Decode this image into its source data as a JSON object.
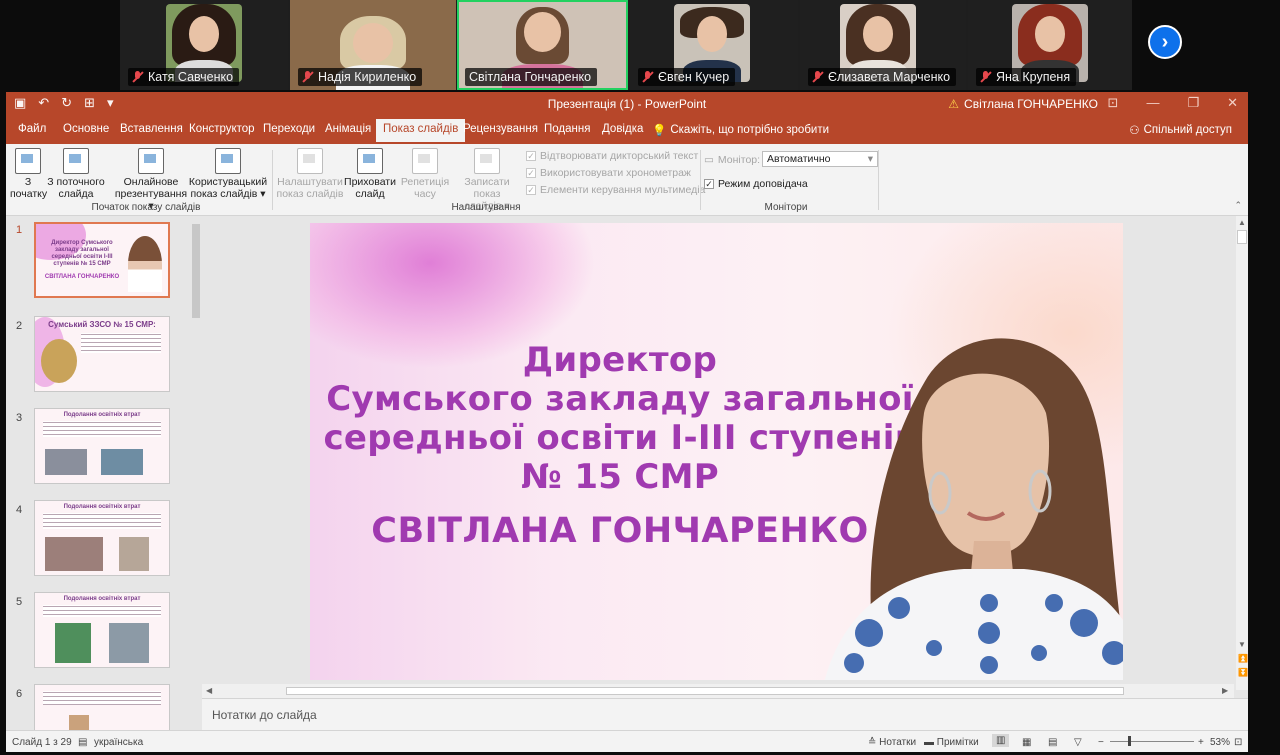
{
  "participants": [
    {
      "name": "Катя Савченко",
      "muted": true
    },
    {
      "name": "Надія Кириленко",
      "muted": true
    },
    {
      "name": "Світлана Гончаренко",
      "muted": false,
      "active": true
    },
    {
      "name": "Євген Кучер",
      "muted": true
    },
    {
      "name": "Єлизавета Марченко",
      "muted": true
    },
    {
      "name": "Яна Крупеня",
      "muted": true
    }
  ],
  "titlebar": {
    "title": "Презентація (1)  -  PowerPoint",
    "user": "Світлана ГОНЧАРЕНКО"
  },
  "menu": {
    "tabs": [
      "Файл",
      "Основне",
      "Вставлення",
      "Конструктор",
      "Переходи",
      "Анімація",
      "Показ слайдів",
      "Рецензування",
      "Подання",
      "Довідка"
    ],
    "active_tab": "Показ слайдів",
    "tell_me": "Скажіть, що потрібно зробити",
    "share": "Спільний доступ"
  },
  "ribbon": {
    "from_beginning": [
      "З",
      "початку"
    ],
    "from_current": [
      "З поточного",
      "слайда"
    ],
    "online": [
      "Онлайнове",
      "презентування ▾"
    ],
    "custom": [
      "Користувацький",
      "показ слайдів ▾"
    ],
    "group_start": "Початок показу слайдів",
    "setup": [
      "Налаштувати",
      "показ слайдів"
    ],
    "hide": [
      "Приховати",
      "слайд"
    ],
    "rehearse": [
      "Репетиція",
      "часу"
    ],
    "record": [
      "Записати показ",
      "слайдів ▾"
    ],
    "chk_narration": "Відтворювати дикторський текст",
    "chk_timings": "Використовувати хронометраж",
    "chk_media": "Елементи керування мультимедіа",
    "group_setup": "Налаштування",
    "monitor_label": "Монітор:",
    "monitor_value": "Автоматично",
    "presenter_view": "Режим доповідача",
    "group_monitors": "Монітори"
  },
  "thumbnails": [
    {
      "num": "1",
      "title": "Директор Сумського закладу загальної середньої освіти І-ІІІ ступенів № 15 СМР",
      "sub": "СВІТЛАНА ГОНЧАРЕНКО"
    },
    {
      "num": "2",
      "title": "Сумський ЗЗСО № 15 СМР:"
    },
    {
      "num": "3",
      "title": "Подолання освітніх втрат"
    },
    {
      "num": "4",
      "title": "Подолання освітніх втрат"
    },
    {
      "num": "5",
      "title": "Подолання освітніх втрат"
    },
    {
      "num": "6",
      "title": ""
    }
  ],
  "slide": {
    "lines": [
      "Директор",
      "Сумського закладу загальної",
      "середньої освіти І-ІІІ ступенів",
      "№ 15 СМР"
    ],
    "name": "СВІТЛАНА ГОНЧАРЕНКО"
  },
  "notes_placeholder": "Нотатки до слайда",
  "status": {
    "slide_of": "Слайд 1 з 29",
    "language": "українська",
    "notes": "Нотатки",
    "comments": "Примітки",
    "zoom": "53%"
  },
  "colors": {
    "ppt_accent": "#b7472a",
    "slide_text": "#a03ab0",
    "active_speaker": "#23d160"
  }
}
